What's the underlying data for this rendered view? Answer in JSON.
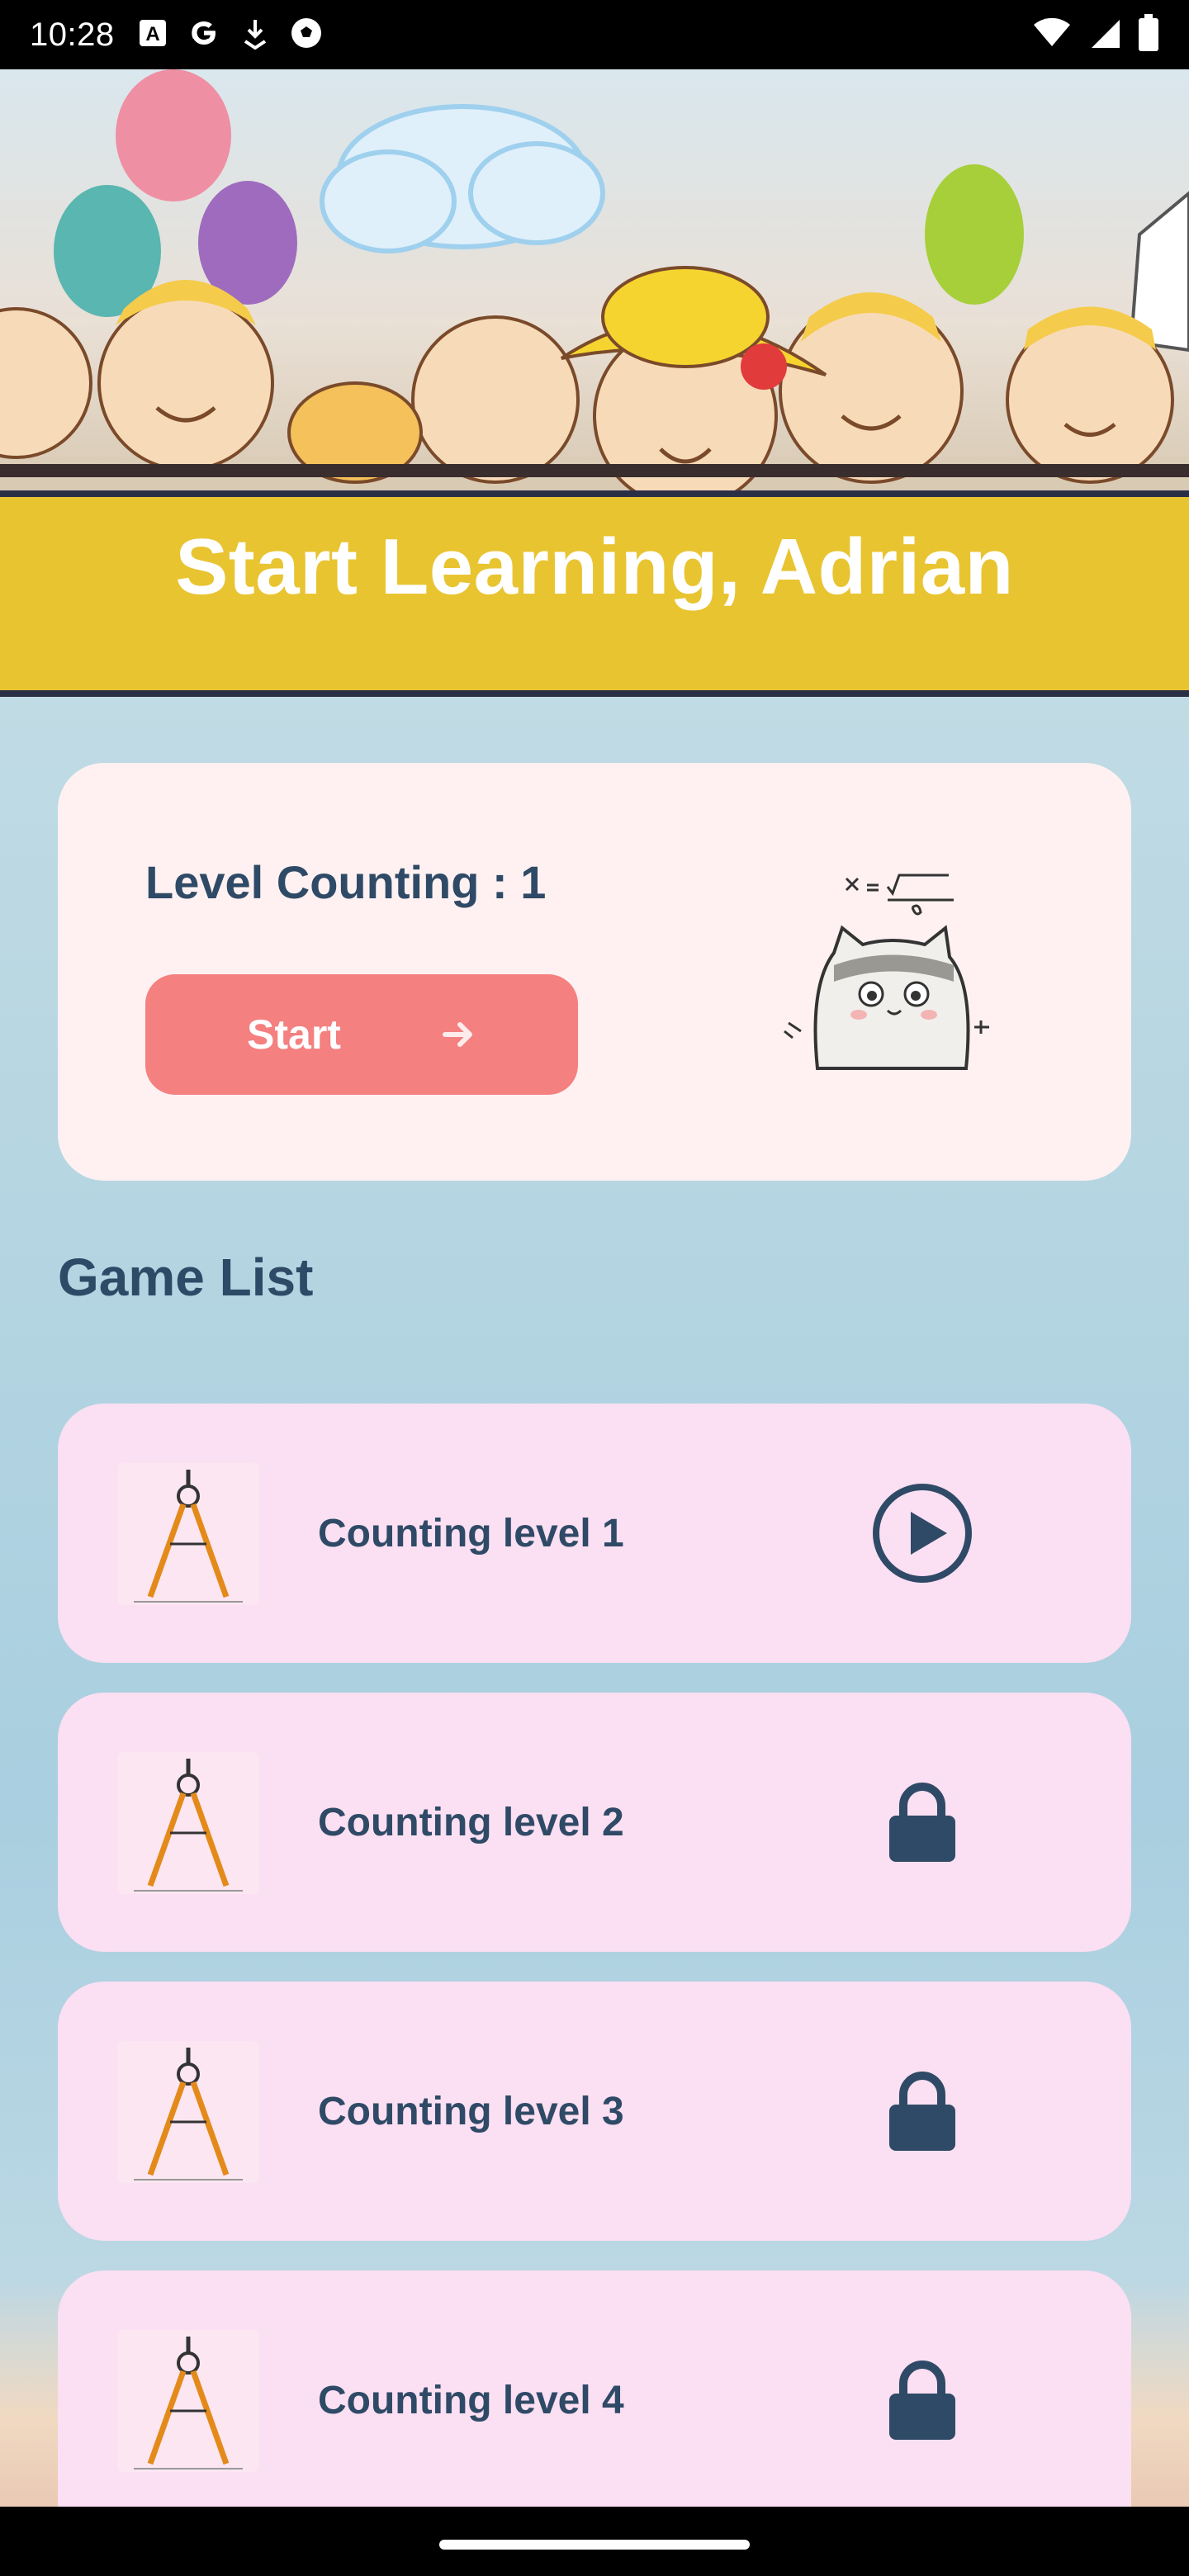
{
  "status_bar": {
    "time": "10:28",
    "icons": [
      "a-box-icon",
      "google-icon",
      "download-icon",
      "soccer-icon"
    ],
    "right_icons": [
      "wifi-icon",
      "signal-icon",
      "battery-icon"
    ]
  },
  "banner": {
    "title": "Start Learning, Adrian"
  },
  "level_card": {
    "title": "Level Counting : 1",
    "start_label": "Start"
  },
  "game_list": {
    "title": "Game List",
    "items": [
      {
        "label": "Counting level 1",
        "status": "play"
      },
      {
        "label": "Counting level 2",
        "status": "locked"
      },
      {
        "label": "Counting level 3",
        "status": "locked"
      },
      {
        "label": "Counting level 4",
        "status": "locked"
      }
    ]
  },
  "colors": {
    "banner": "#e8c431",
    "card_bg": "#fff1f1",
    "item_bg": "#fbdff2",
    "start_button": "#f48080",
    "text_primary": "#2f4a66"
  }
}
